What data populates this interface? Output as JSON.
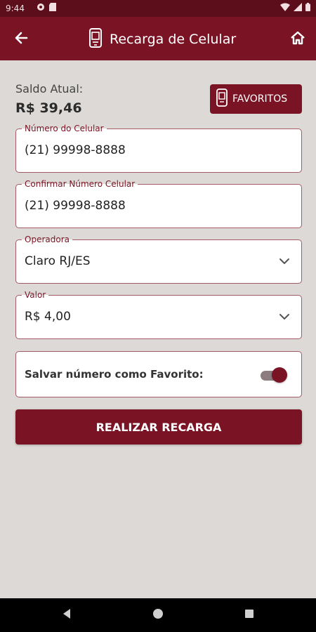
{
  "status_bar": {
    "time": "9:44"
  },
  "app_bar": {
    "title": "Recarga de Celular"
  },
  "balance": {
    "label": "Saldo Atual:",
    "value": "R$ 39,46"
  },
  "favorites_button": {
    "label": "FAVORITOS"
  },
  "fields": [
    {
      "label": "Número do Celular",
      "value": "(21) 99998-8888"
    },
    {
      "label": "Confirmar Número Celular",
      "value": "(21) 99998-8888"
    },
    {
      "label": "Operadora",
      "value": "Claro RJ/ES"
    },
    {
      "label": "Valor",
      "value": "R$ 4,00"
    }
  ],
  "save_favorite": {
    "label": "Salvar número como Favorito:",
    "enabled": true
  },
  "submit_button": {
    "label": "REALIZAR RECARGA"
  },
  "colors": {
    "primary": "#7a1424",
    "status_bar": "#5c0f1b",
    "background": "#dcd9d6"
  }
}
